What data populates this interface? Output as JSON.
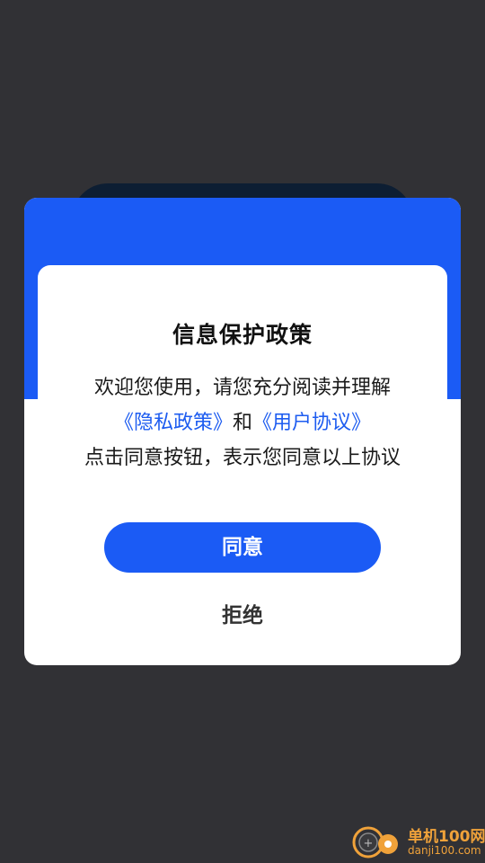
{
  "dialog": {
    "title": "信息保护政策",
    "line1": "欢迎您使用，请您充分阅读并理解",
    "privacy_link": "《隐私政策》",
    "and_text": "和",
    "user_agreement_link": "《用户协议》",
    "line3": "点击同意按钮，表示您同意以上协议",
    "agree_label": "同意",
    "decline_label": "拒绝"
  },
  "watermark": {
    "title": "单机100网",
    "url": "danji100.com",
    "logo_icon": "danji100-logo-icon"
  },
  "colors": {
    "background": "#313135",
    "accent": "#1b5bf5",
    "link": "#1d5cf0",
    "watermark": "#f0a23a"
  }
}
